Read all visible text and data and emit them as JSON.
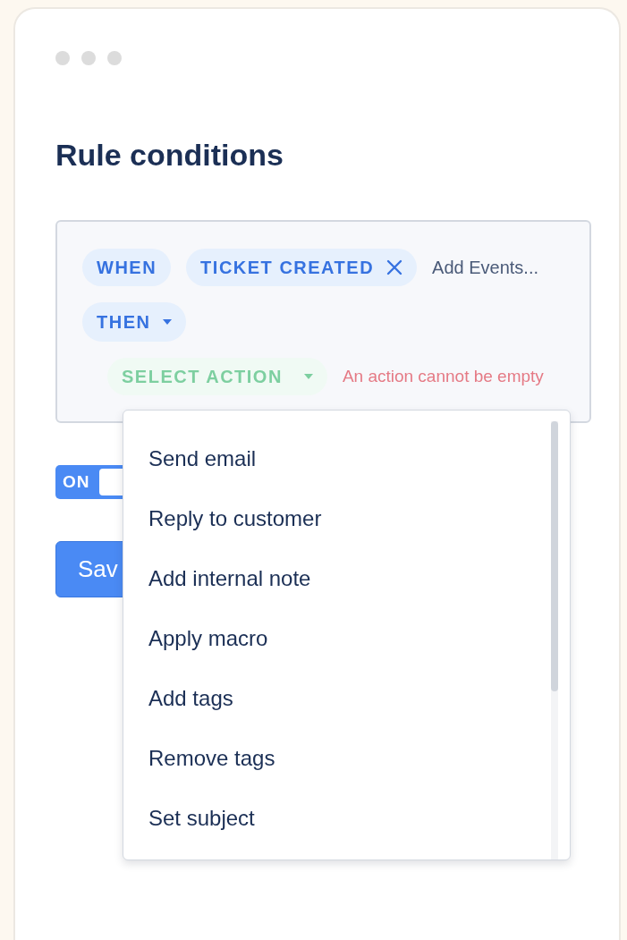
{
  "title": "Rule conditions",
  "conditions": {
    "when": {
      "label": "WHEN"
    },
    "events": [
      {
        "label": "TICKET CREATED"
      }
    ],
    "events_input": {
      "placeholder": "Add Events..."
    },
    "then": {
      "label": "THEN"
    },
    "action": {
      "label": "SELECT ACTION",
      "error": "An action cannot be empty"
    }
  },
  "toggle": {
    "label": "ON",
    "on": true
  },
  "save_button": {
    "label": "Sav"
  },
  "action_menu": {
    "items": [
      {
        "label": "Send email",
        "selected": false
      },
      {
        "label": "Reply to customer",
        "selected": false
      },
      {
        "label": "Add internal note",
        "selected": false
      },
      {
        "label": "Apply macro",
        "selected": false
      },
      {
        "label": "Add tags",
        "selected": false
      },
      {
        "label": "Remove tags",
        "selected": false
      },
      {
        "label": "Set subject",
        "selected": false
      }
    ]
  }
}
